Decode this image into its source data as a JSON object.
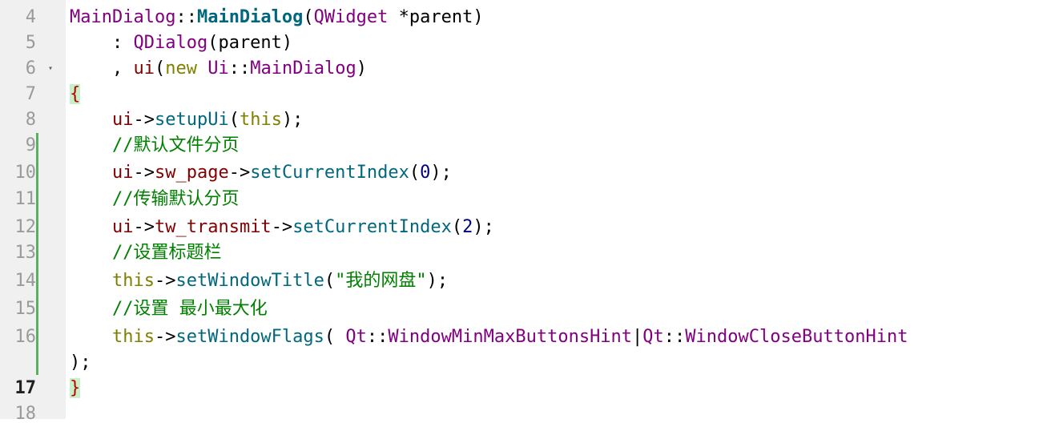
{
  "editor": {
    "lines": [
      {
        "num": "4",
        "tokens": [
          {
            "t": "MainDialog",
            "c": "type"
          },
          {
            "t": "::",
            "c": "pl"
          },
          {
            "t": "MainDialog",
            "c": "func-b"
          },
          {
            "t": "(",
            "c": "pl"
          },
          {
            "t": "QWidget",
            "c": "type"
          },
          {
            "t": " *",
            "c": "pl"
          },
          {
            "t": "parent",
            "c": "pl"
          },
          {
            "t": ")",
            "c": "pl"
          }
        ]
      },
      {
        "num": "5",
        "tokens": [
          {
            "t": "    : ",
            "c": "pl"
          },
          {
            "t": "QDialog",
            "c": "type"
          },
          {
            "t": "(parent)",
            "c": "pl"
          }
        ]
      },
      {
        "num": "6",
        "fold": true,
        "tokens": [
          {
            "t": "    , ",
            "c": "pl"
          },
          {
            "t": "ui",
            "c": "mem"
          },
          {
            "t": "(",
            "c": "pl"
          },
          {
            "t": "new",
            "c": "kw"
          },
          {
            "t": " ",
            "c": "pl"
          },
          {
            "t": "Ui",
            "c": "type"
          },
          {
            "t": "::",
            "c": "pl"
          },
          {
            "t": "MainDialog",
            "c": "type"
          },
          {
            "t": ")",
            "c": "pl"
          }
        ]
      },
      {
        "num": "7",
        "tokens": [
          {
            "t": "{",
            "c": "red",
            "hl": true
          }
        ]
      },
      {
        "num": "8",
        "tokens": [
          {
            "t": "    ",
            "c": "pl"
          },
          {
            "t": "ui",
            "c": "mem"
          },
          {
            "t": "->",
            "c": "pl"
          },
          {
            "t": "setupUi",
            "c": "func"
          },
          {
            "t": "(",
            "c": "pl"
          },
          {
            "t": "this",
            "c": "kw"
          },
          {
            "t": ");",
            "c": "pl"
          }
        ]
      },
      {
        "num": "9",
        "tokens": [
          {
            "t": "    ",
            "c": "pl"
          },
          {
            "t": "//默认文件分页",
            "c": "cmt"
          }
        ]
      },
      {
        "num": "10",
        "tokens": [
          {
            "t": "    ",
            "c": "pl"
          },
          {
            "t": "ui",
            "c": "mem"
          },
          {
            "t": "->",
            "c": "pl"
          },
          {
            "t": "sw_page",
            "c": "mem"
          },
          {
            "t": "->",
            "c": "pl"
          },
          {
            "t": "setCurrentIndex",
            "c": "func"
          },
          {
            "t": "(",
            "c": "pl"
          },
          {
            "t": "0",
            "c": "num"
          },
          {
            "t": ");",
            "c": "pl"
          }
        ]
      },
      {
        "num": "11",
        "tokens": [
          {
            "t": "    ",
            "c": "pl"
          },
          {
            "t": "//传输默认分页",
            "c": "cmt"
          }
        ]
      },
      {
        "num": "12",
        "tokens": [
          {
            "t": "    ",
            "c": "pl"
          },
          {
            "t": "ui",
            "c": "mem"
          },
          {
            "t": "->",
            "c": "pl"
          },
          {
            "t": "tw_transmit",
            "c": "mem"
          },
          {
            "t": "->",
            "c": "pl"
          },
          {
            "t": "setCurrentIndex",
            "c": "func"
          },
          {
            "t": "(",
            "c": "pl"
          },
          {
            "t": "2",
            "c": "num"
          },
          {
            "t": ");",
            "c": "pl"
          }
        ]
      },
      {
        "num": "13",
        "tokens": [
          {
            "t": "    ",
            "c": "pl"
          },
          {
            "t": "//设置标题栏",
            "c": "cmt"
          }
        ]
      },
      {
        "num": "14",
        "tokens": [
          {
            "t": "    ",
            "c": "pl"
          },
          {
            "t": "this",
            "c": "kw"
          },
          {
            "t": "->",
            "c": "pl"
          },
          {
            "t": "setWindowTitle",
            "c": "func"
          },
          {
            "t": "(",
            "c": "pl"
          },
          {
            "t": "\"我的网盘\"",
            "c": "str"
          },
          {
            "t": ");",
            "c": "pl"
          }
        ]
      },
      {
        "num": "15",
        "tokens": [
          {
            "t": "    ",
            "c": "pl"
          },
          {
            "t": "//设置 最小最大化",
            "c": "cmt"
          }
        ]
      },
      {
        "num": "16",
        "tokens": [
          {
            "t": "    ",
            "c": "pl"
          },
          {
            "t": "this",
            "c": "kw"
          },
          {
            "t": "->",
            "c": "pl"
          },
          {
            "t": "setWindowFlags",
            "c": "func"
          },
          {
            "t": "( ",
            "c": "pl"
          },
          {
            "t": "Qt",
            "c": "type"
          },
          {
            "t": "::",
            "c": "pl"
          },
          {
            "t": "WindowMinMaxButtonsHint",
            "c": "type"
          },
          {
            "t": "|",
            "c": "pl"
          },
          {
            "t": "Qt",
            "c": "type"
          },
          {
            "t": "::",
            "c": "pl"
          },
          {
            "t": "WindowCloseButtonHint",
            "c": "type"
          }
        ]
      },
      {
        "num": "",
        "tokens": [
          {
            "t": ");",
            "c": "pl"
          }
        ]
      },
      {
        "num": "17",
        "current": true,
        "tokens": [
          {
            "t": "}",
            "c": "red",
            "hl": true
          }
        ]
      },
      {
        "num": "18",
        "tokens": []
      }
    ]
  }
}
